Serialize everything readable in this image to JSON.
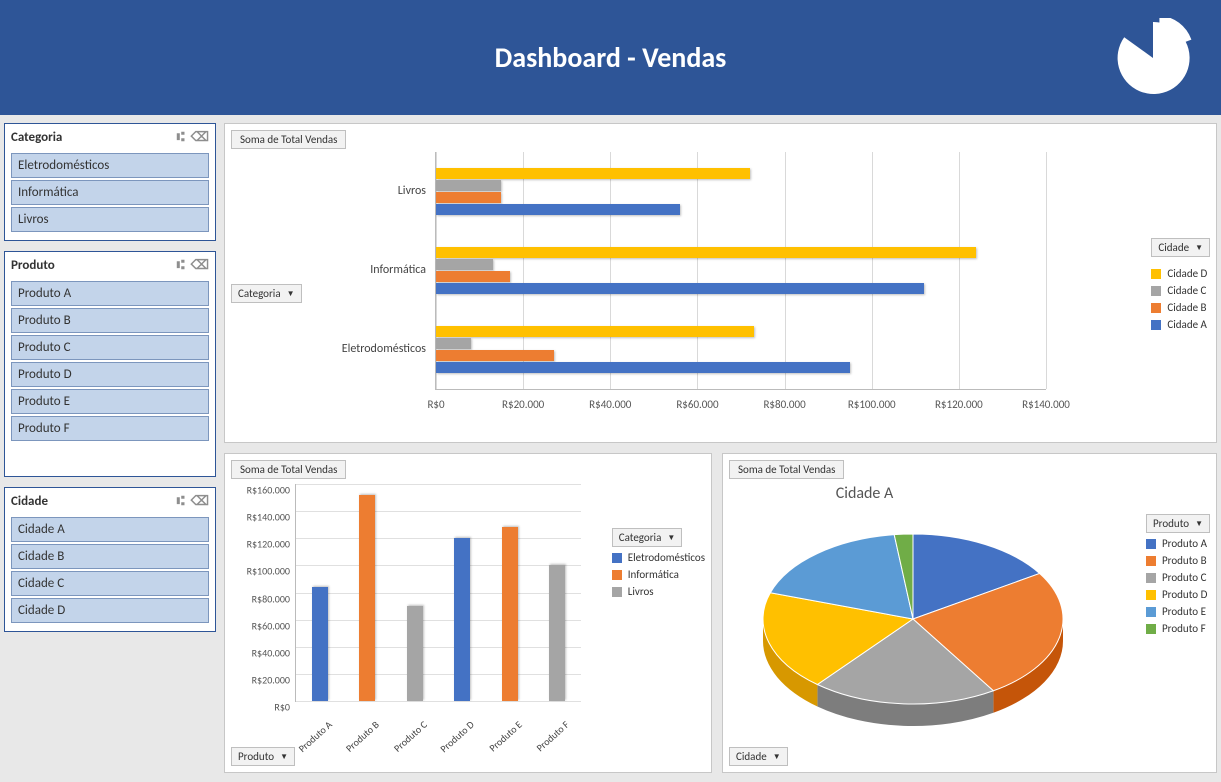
{
  "header": {
    "title": "Dashboard - Vendas"
  },
  "slicers": {
    "categoria": {
      "title": "Categoria",
      "items": [
        "Eletrodomésticos",
        "Informática",
        "Livros"
      ]
    },
    "produto": {
      "title": "Produto",
      "items": [
        "Produto A",
        "Produto B",
        "Produto C",
        "Produto D",
        "Produto E",
        "Produto F"
      ]
    },
    "cidade": {
      "title": "Cidade",
      "items": [
        "Cidade A",
        "Cidade B",
        "Cidade C",
        "Cidade D"
      ]
    }
  },
  "panels": {
    "top": {
      "title": "Soma de Total Vendas",
      "axis_btn": "Categoria",
      "legend_btn": "Cidade"
    },
    "bar": {
      "title": "Soma de Total Vendas",
      "axis_btn": "Produto",
      "legend_btn": "Categoria"
    },
    "pie": {
      "title": "Soma de Total Vendas",
      "chart_title": "Cidade A",
      "axis_btn": "Cidade",
      "legend_btn": "Produto"
    }
  },
  "legend_cities": [
    "Cidade D",
    "Cidade C",
    "Cidade B",
    "Cidade A"
  ],
  "legend_cats": [
    "Eletrodomésticos",
    "Informática",
    "Livros"
  ],
  "legend_prods": [
    "Produto A",
    "Produto B",
    "Produto C",
    "Produto D",
    "Produto E",
    "Produto F"
  ],
  "axis1_ticks": [
    "R$0",
    "R$20.000",
    "R$40.000",
    "R$60.000",
    "R$80.000",
    "R$100.000",
    "R$120.000",
    "R$140.000"
  ],
  "axis2_ticks": [
    "R$0",
    "R$20.000",
    "R$40.000",
    "R$60.000",
    "R$80.000",
    "R$100.000",
    "R$120.000",
    "R$140.000",
    "R$160.000"
  ],
  "chart_data": [
    {
      "id": "top",
      "type": "bar",
      "orientation": "horizontal",
      "title": "Soma de Total Vendas",
      "xlabel": "",
      "ylabel": "",
      "xlim": [
        0,
        140000
      ],
      "categories": [
        "Livros",
        "Informática",
        "Eletrodomésticos"
      ],
      "series": [
        {
          "name": "Cidade D",
          "color": "#ffc000",
          "values": [
            72000,
            124000,
            73000
          ]
        },
        {
          "name": "Cidade C",
          "color": "#a5a5a5",
          "values": [
            15000,
            13000,
            8000
          ]
        },
        {
          "name": "Cidade B",
          "color": "#ed7d31",
          "values": [
            15000,
            17000,
            27000
          ]
        },
        {
          "name": "Cidade A",
          "color": "#4472c4",
          "values": [
            56000,
            112000,
            95000
          ]
        }
      ]
    },
    {
      "id": "bar",
      "type": "bar",
      "orientation": "vertical",
      "title": "Soma de Total Vendas",
      "ylim": [
        0,
        160000
      ],
      "categories": [
        "Produto A",
        "Produto B",
        "Produto C",
        "Produto D",
        "Produto E",
        "Produto F"
      ],
      "series": [
        {
          "name": "Eletrodomésticos",
          "color": "#4472c4",
          "values": [
            84000,
            null,
            null,
            120000,
            null,
            null
          ]
        },
        {
          "name": "Informática",
          "color": "#ed7d31",
          "values": [
            null,
            152000,
            null,
            null,
            128000,
            null
          ]
        },
        {
          "name": "Livros",
          "color": "#a5a5a5",
          "values": [
            null,
            null,
            70000,
            null,
            null,
            100000
          ]
        }
      ]
    },
    {
      "id": "pie",
      "type": "pie",
      "title": "Cidade A",
      "series": [
        {
          "name": "Produto A",
          "color": "#4472c4",
          "value": 16
        },
        {
          "name": "Produto B",
          "color": "#ed7d31",
          "value": 25
        },
        {
          "name": "Produto C",
          "color": "#a5a5a5",
          "value": 20
        },
        {
          "name": "Produto D",
          "color": "#ffc000",
          "value": 19
        },
        {
          "name": "Produto E",
          "color": "#5b9bd5",
          "value": 18
        },
        {
          "name": "Produto F",
          "color": "#70ad47",
          "value": 2
        }
      ]
    }
  ]
}
